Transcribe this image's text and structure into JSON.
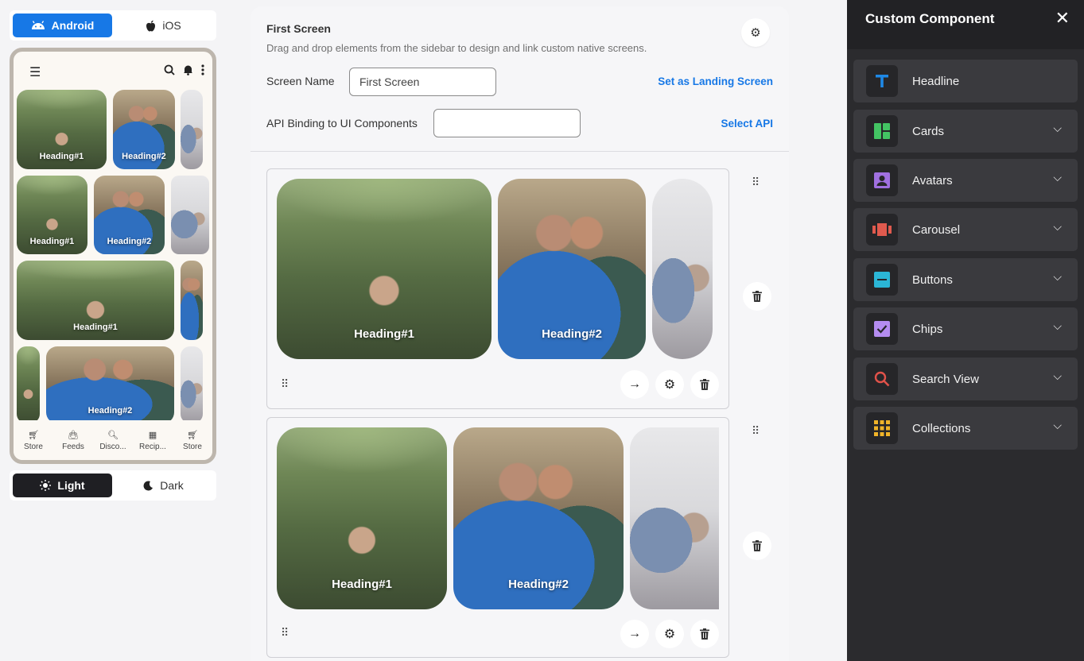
{
  "platform": {
    "android": "Android",
    "ios": "iOS"
  },
  "theme": {
    "light": "Light",
    "dark": "Dark"
  },
  "phone": {
    "cards": [
      "Heading#1",
      "Heading#2",
      "Heading#1",
      "Heading#2",
      "Heading#1",
      "Heading#2"
    ],
    "nav": [
      "Store",
      "Feeds",
      "Disco...",
      "Recip...",
      "Store"
    ]
  },
  "editor": {
    "title": "First Screen",
    "subtitle": "Drag and drop elements from the sidebar to design and link custom native screens.",
    "screen_name_label": "Screen Name",
    "screen_name_value": "First Screen",
    "landing_link": "Set as Landing Screen",
    "api_label": "API Binding to UI Components",
    "api_value": "",
    "api_link": "Select API",
    "blocks": [
      {
        "cards": [
          "Heading#1",
          "Heading#2"
        ]
      },
      {
        "cards": [
          "Heading#1",
          "Heading#2"
        ]
      }
    ]
  },
  "sidebar": {
    "title": "Custom Component",
    "items": [
      {
        "label": "Headline",
        "icon": "headline-icon",
        "color": "#1e88e5"
      },
      {
        "label": "Cards",
        "icon": "cards-icon",
        "color": "#43c463"
      },
      {
        "label": "Avatars",
        "icon": "avatars-icon",
        "color": "#a070e0"
      },
      {
        "label": "Carousel",
        "icon": "carousel-icon",
        "color": "#e05a4e"
      },
      {
        "label": "Buttons",
        "icon": "buttons-icon",
        "color": "#2bb6d6"
      },
      {
        "label": "Chips",
        "icon": "chips-icon",
        "color": "#b48cf0"
      },
      {
        "label": "Search View",
        "icon": "search-view-icon",
        "color": "#e0524a"
      },
      {
        "label": "Collections",
        "icon": "collections-icon",
        "color": "#f0b429"
      }
    ]
  }
}
